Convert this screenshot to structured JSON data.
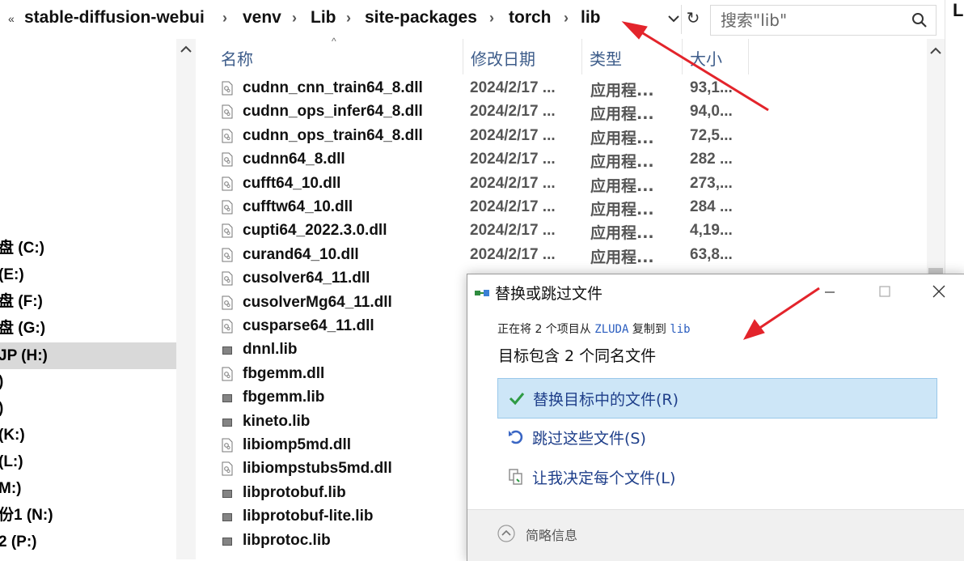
{
  "address_bar": {
    "overflow_label": "«",
    "crumbs": [
      "stable-diffusion-webui",
      "venv",
      "Lib",
      "site-packages",
      "torch",
      "lib"
    ],
    "separator": "›",
    "refresh_glyph": "↻"
  },
  "search": {
    "placeholder": "搜索\"lib\""
  },
  "window_edge_text": "L",
  "nav": {
    "items": [
      {
        "label": "盘 (C:)"
      },
      {
        "label": "(E:)"
      },
      {
        "label": "盘 (F:)"
      },
      {
        "label": "盘 (G:)"
      },
      {
        "label": "JP (H:)",
        "selected": true
      },
      {
        "label": ")"
      },
      {
        "label": ")"
      },
      {
        "label": "(K:)"
      },
      {
        "label": "(L:)"
      },
      {
        "label": "M:)"
      },
      {
        "label": "份1 (N:)"
      },
      {
        "label": "2 (P:)"
      }
    ]
  },
  "columns": {
    "name": "名称",
    "date": "修改日期",
    "type": "类型",
    "size": "大小"
  },
  "files": [
    {
      "name": "cudnn_cnn_train64_8.dll",
      "date": "2024/2/17 ...",
      "type": "应用程...",
      "size": "93,1...",
      "icon": "dll"
    },
    {
      "name": "cudnn_ops_infer64_8.dll",
      "date": "2024/2/17 ...",
      "type": "应用程...",
      "size": "94,0...",
      "icon": "dll"
    },
    {
      "name": "cudnn_ops_train64_8.dll",
      "date": "2024/2/17 ...",
      "type": "应用程...",
      "size": "72,5...",
      "icon": "dll"
    },
    {
      "name": "cudnn64_8.dll",
      "date": "2024/2/17 ...",
      "type": "应用程...",
      "size": "282 ...",
      "icon": "dll"
    },
    {
      "name": "cufft64_10.dll",
      "date": "2024/2/17 ...",
      "type": "应用程...",
      "size": "273,...",
      "icon": "dll"
    },
    {
      "name": "cufftw64_10.dll",
      "date": "2024/2/17 ...",
      "type": "应用程...",
      "size": "284 ...",
      "icon": "dll"
    },
    {
      "name": "cupti64_2022.3.0.dll",
      "date": "2024/2/17 ...",
      "type": "应用程...",
      "size": "4,19...",
      "icon": "dll"
    },
    {
      "name": "curand64_10.dll",
      "date": "2024/2/17 ...",
      "type": "应用程...",
      "size": "63,8...",
      "icon": "dll"
    },
    {
      "name": "cusolver64_11.dll",
      "date": "",
      "type": "",
      "size": "",
      "icon": "dll"
    },
    {
      "name": "cusolverMg64_11.dll",
      "date": "",
      "type": "",
      "size": "",
      "icon": "dll"
    },
    {
      "name": "cusparse64_11.dll",
      "date": "",
      "type": "",
      "size": "",
      "icon": "dll"
    },
    {
      "name": "dnnl.lib",
      "date": "",
      "type": "",
      "size": "",
      "icon": "lib"
    },
    {
      "name": "fbgemm.dll",
      "date": "",
      "type": "",
      "size": "",
      "icon": "dll"
    },
    {
      "name": "fbgemm.lib",
      "date": "",
      "type": "",
      "size": "",
      "icon": "lib"
    },
    {
      "name": "kineto.lib",
      "date": "",
      "type": "",
      "size": "",
      "icon": "lib"
    },
    {
      "name": "libiomp5md.dll",
      "date": "",
      "type": "",
      "size": "",
      "icon": "dll"
    },
    {
      "name": "libiompstubs5md.dll",
      "date": "",
      "type": "",
      "size": "",
      "icon": "dll"
    },
    {
      "name": "libprotobuf.lib",
      "date": "",
      "type": "",
      "size": "",
      "icon": "lib"
    },
    {
      "name": "libprotobuf-lite.lib",
      "date": "",
      "type": "",
      "size": "",
      "icon": "lib"
    },
    {
      "name": "libprotoc.lib",
      "date": "",
      "type": "",
      "size": "",
      "icon": "lib"
    }
  ],
  "dialog": {
    "title": "替换或跳过文件",
    "subtitle_pre": "正在将 2 个项目从",
    "source": "ZLUDA",
    "subtitle_mid": "复制到",
    "dest": "lib",
    "heading": "目标包含 2 个同名文件",
    "options": [
      {
        "label": "替换目标中的文件(R)",
        "icon": "check-icon"
      },
      {
        "label": "跳过这些文件(S)",
        "icon": "undo-icon"
      },
      {
        "label": "让我决定每个文件(L)",
        "icon": "copy-files-icon"
      }
    ],
    "footer": "简略信息"
  },
  "colors": {
    "accent": "#1f3f8a",
    "selection": "#cde6f7",
    "annotation": "#e3242b"
  }
}
